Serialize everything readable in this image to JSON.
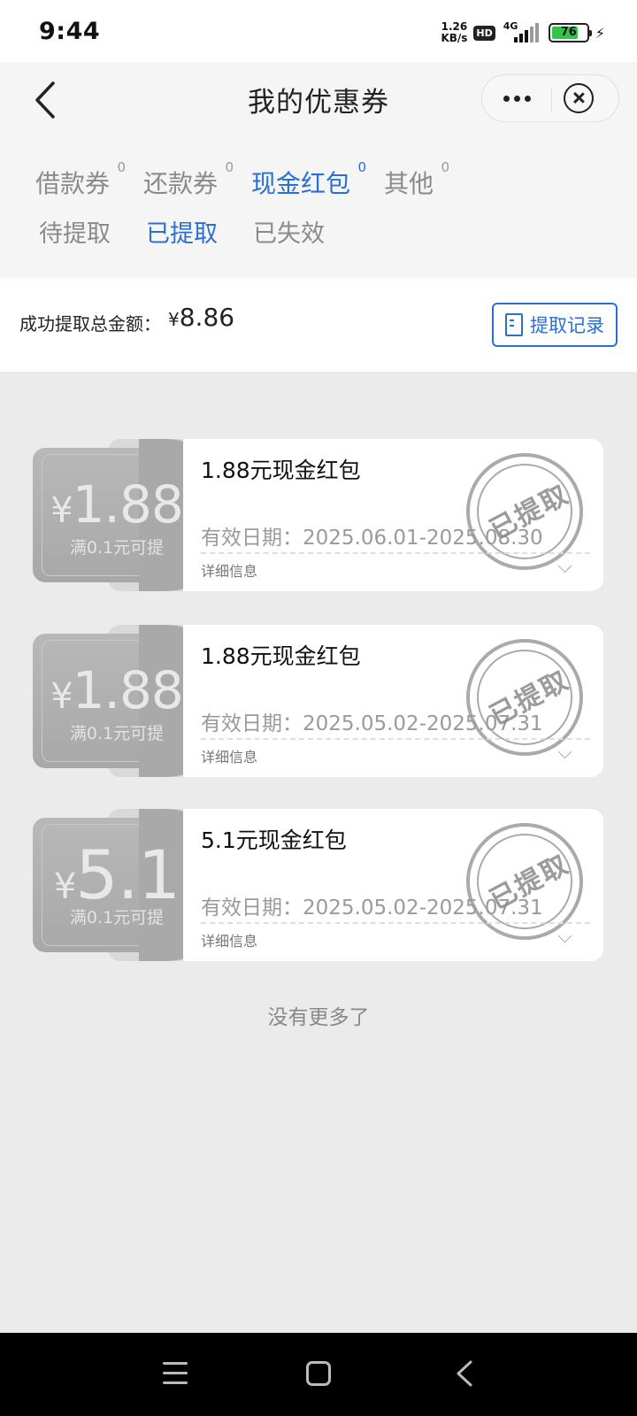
{
  "status_bar": {
    "time": "9:44",
    "net_speed_value": "1.26",
    "net_speed_unit": "KB/s",
    "hd": "HD",
    "network": "4G",
    "battery": "76"
  },
  "header": {
    "title": "我的优惠券"
  },
  "tabs": [
    {
      "label": "借款券",
      "count": "0"
    },
    {
      "label": "还款券",
      "count": "0"
    },
    {
      "label": "现金红包",
      "count": "0"
    },
    {
      "label": "其他",
      "count": "0"
    }
  ],
  "subtabs": [
    "待提取",
    "已提取",
    "已失效"
  ],
  "summary": {
    "label": "成功提取总金额：",
    "currency": "¥",
    "amount": "8.86",
    "record_button": "提取记录"
  },
  "coupons": [
    {
      "currency": "¥",
      "amount": "1.88",
      "condition": "满0.1元可提",
      "name": "1.88元现金红包",
      "dates": "有效日期：2025.06.01-2025.08.30",
      "detail": "详细信息",
      "stamp": "已提取"
    },
    {
      "currency": "¥",
      "amount": "1.88",
      "condition": "满0.1元可提",
      "name": "1.88元现金红包",
      "dates": "有效日期：2025.05.02-2025.07.31",
      "detail": "详细信息",
      "stamp": "已提取"
    },
    {
      "currency": "¥",
      "amount": "5.1",
      "condition": "满0.1元可提",
      "name": "5.1元现金红包",
      "dates": "有效日期：2025.05.02-2025.07.31",
      "detail": "详细信息",
      "stamp": "已提取"
    }
  ],
  "footer": {
    "no_more": "没有更多了"
  },
  "colors": {
    "accent": "#2a6fd6",
    "background": "#ebebeb"
  }
}
